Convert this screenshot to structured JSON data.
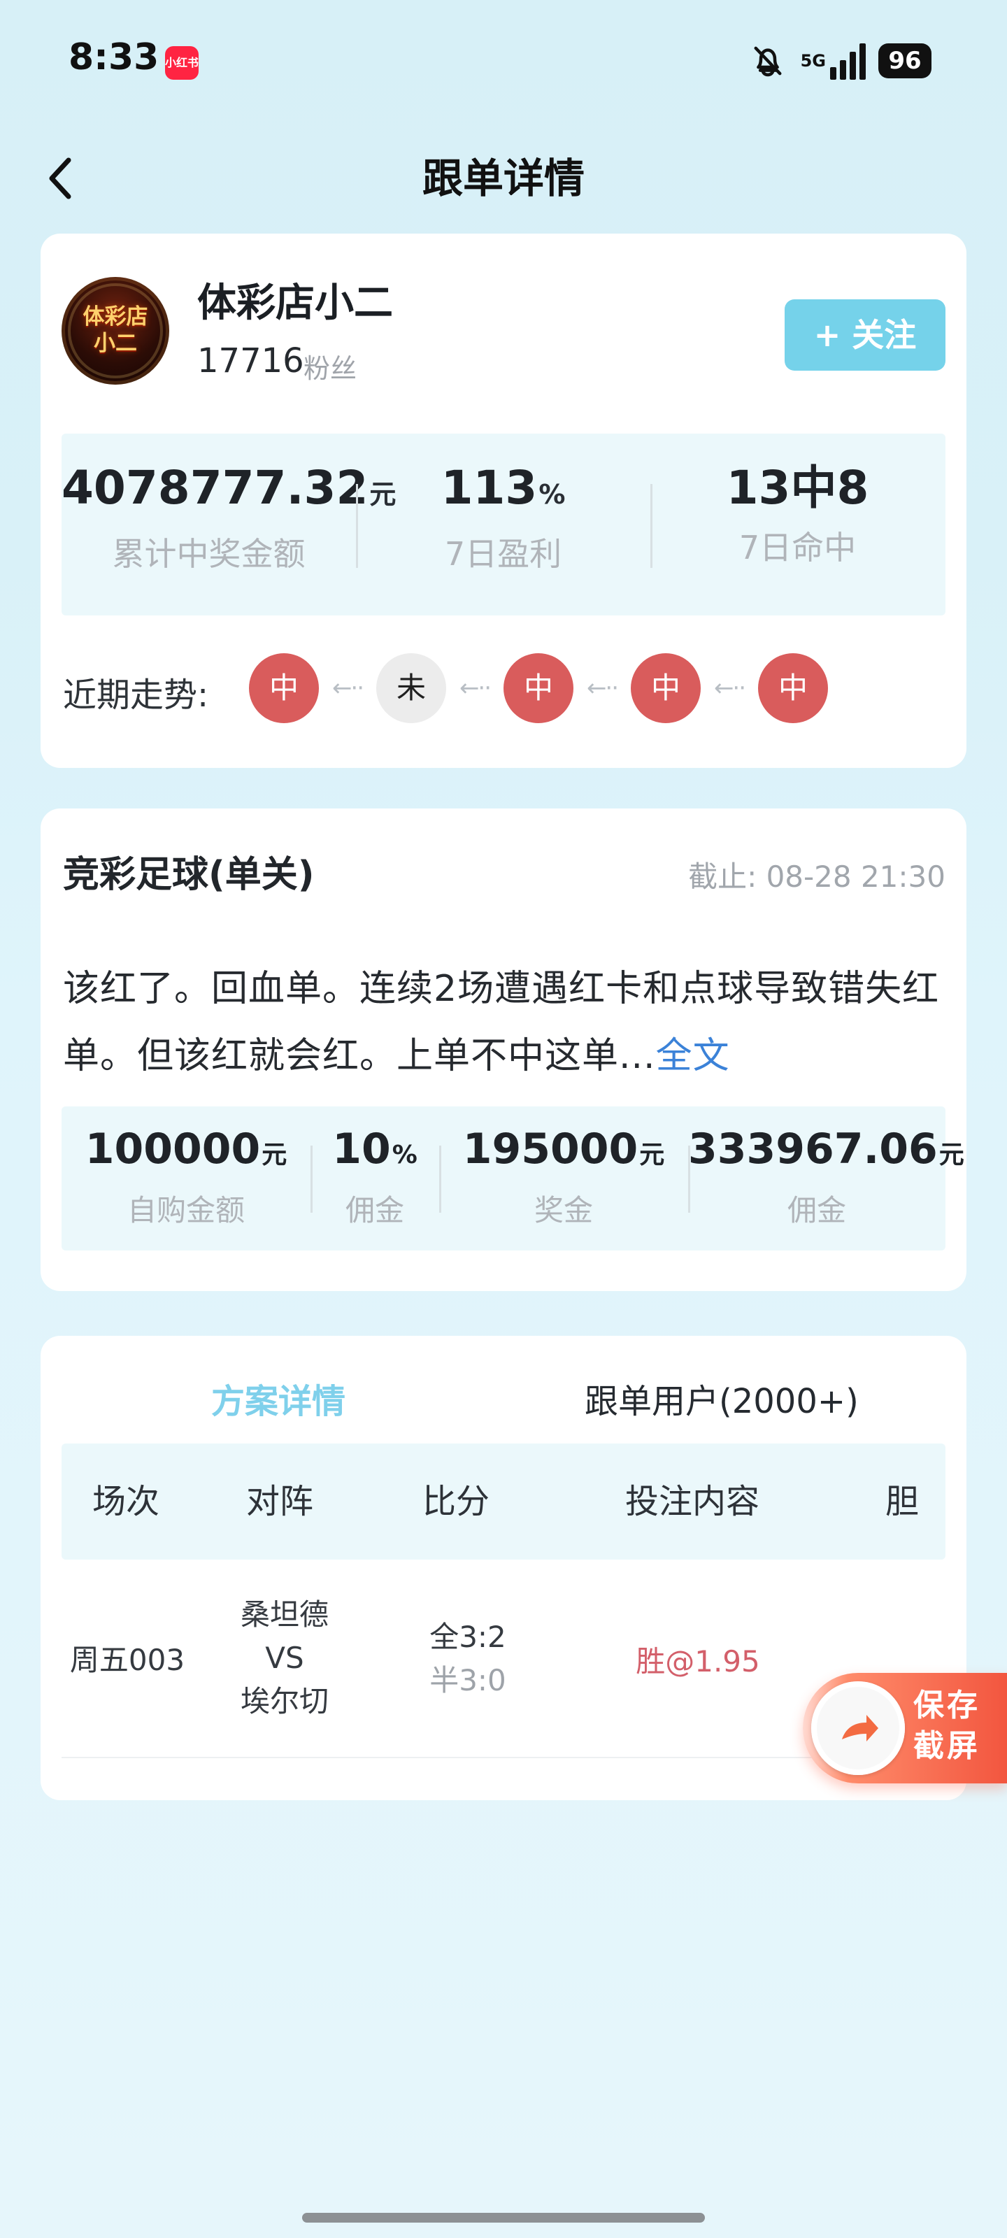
{
  "status_bar": {
    "time": "8:33",
    "app_icon_text": "小红书",
    "network_label": "5G",
    "battery": "96",
    "signal_bars": 4,
    "icons": [
      "notification-off-icon",
      "signal-icon",
      "battery-icon"
    ]
  },
  "nav": {
    "title": "跟单详情",
    "back_icon": "chevron-left-icon"
  },
  "profile": {
    "avatar_text": "体彩店\n小二",
    "name": "体彩店小二",
    "fans_count": "17716",
    "fans_label": "粉丝",
    "follow_button": "+ 关注"
  },
  "stats": {
    "total_prize": {
      "value": "4078777.32",
      "unit": "元",
      "label": "累计中奖金额"
    },
    "profit_7d": {
      "value": "113",
      "unit": "%",
      "label": "7日盈利"
    },
    "hit_7d": {
      "value": "13中8",
      "label": "7日命中"
    }
  },
  "trend": {
    "label": "近期走势:",
    "items": [
      "中",
      "未",
      "中",
      "中",
      "中"
    ],
    "arrow": "←··"
  },
  "plan": {
    "type": "竞彩足球(单关)",
    "deadline": "截止: 08-28 21:30",
    "description": "该红了。回血单。连续2场遭遇红卡和点球导致错失红单。但该红就会红。上单不中这单...",
    "more_link": "全文"
  },
  "amounts": [
    {
      "value": "100000",
      "unit": "元",
      "label": "自购金额"
    },
    {
      "value": "10",
      "unit": "%",
      "label": "佣金"
    },
    {
      "value": "195000",
      "unit": "元",
      "label": "奖金"
    },
    {
      "value": "333967.06",
      "unit": "元",
      "label": "佣金"
    }
  ],
  "tabs": {
    "active": "方案详情",
    "inactive": "跟单用户(2000+)"
  },
  "table": {
    "headers": [
      "场次",
      "对阵",
      "比分",
      "投注内容",
      "胆"
    ],
    "rows": [
      {
        "match_no": "周五003",
        "home": "桑坦德",
        "vs": "VS",
        "away": "埃尔切",
        "score_full": "全3:2",
        "score_half": "半3:0",
        "bet": "胜@1.95",
        "banker": ""
      }
    ]
  },
  "floating_button": {
    "label": "保存\n截屏",
    "icon": "share-arrow-icon"
  },
  "colors": {
    "accent": "#75d2ea",
    "hit_red": "#d95c5c",
    "bet_red": "#d35f6a",
    "link_blue": "#3b82d8"
  }
}
